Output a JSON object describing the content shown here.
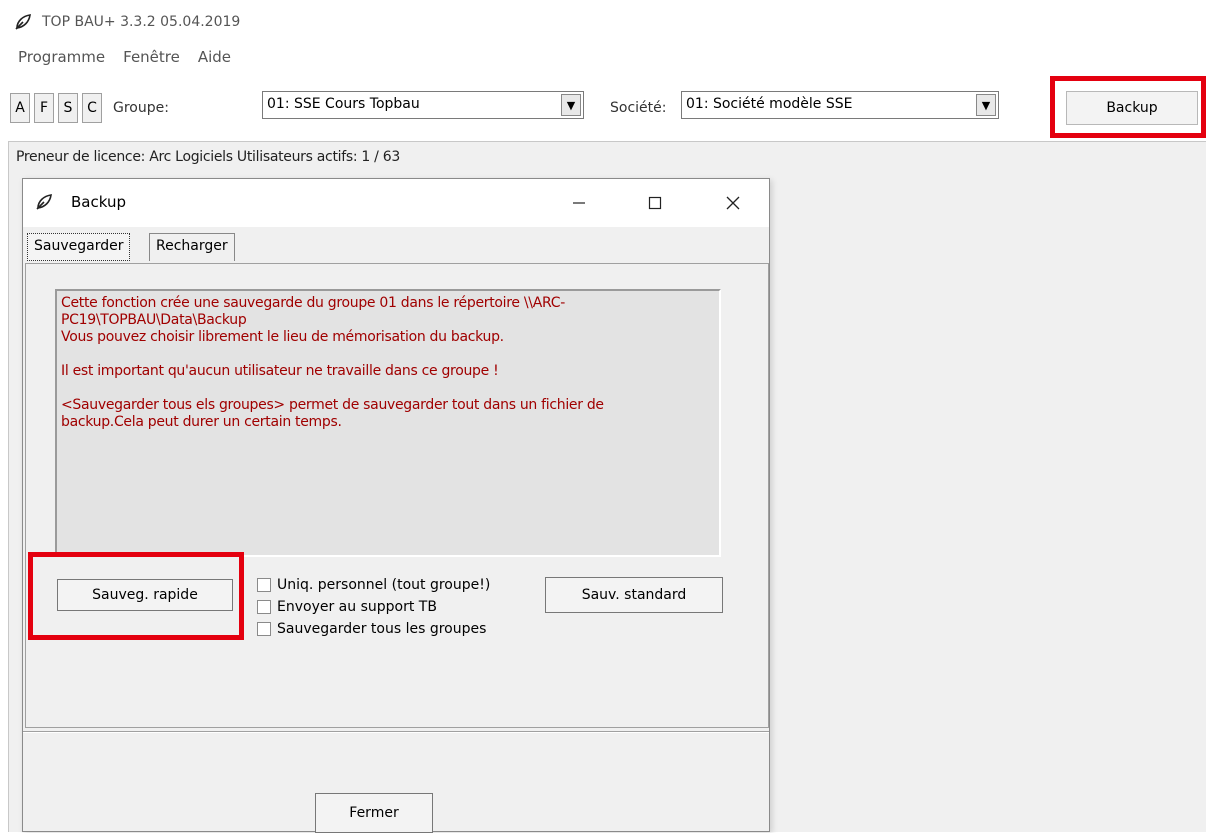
{
  "app": {
    "title": "TOP BAU+ 3.3.2  05.04.2019"
  },
  "menu": {
    "items": [
      "Programme",
      "Fenêtre",
      "Aide"
    ]
  },
  "toolbar": {
    "buttons": [
      "A",
      "F",
      "S",
      "C"
    ],
    "group_label": "Groupe:",
    "group_value": "01: SSE Cours Topbau",
    "company_label": "Société:",
    "company_value": "01: Société modèle SSE",
    "backup_label": "Backup"
  },
  "status": {
    "licence": "Preneur de licence: Arc Logiciels   Utilisateurs actifs: 1 / 63"
  },
  "dialog": {
    "title": "Backup",
    "tabs": [
      "Sauvegarder",
      "Recharger"
    ],
    "info": {
      "line1": "Cette fonction crée une sauvegarde du groupe 01 dans le répertoire \\\\ARC-\nPC19\\TOPBAU\\Data\\Backup\nVous pouvez choisir librement le lieu de mémorisation du backup.",
      "line2": "Il est important qu'aucun utilisateur ne travaille dans ce groupe !",
      "line3": "<Sauvegarder tous els groupes> permet de sauvegarder tout dans un fichier de\nbackup.Cela peut durer un certain temps."
    },
    "quick_save_label": "Sauveg. rapide",
    "standard_save_label": "Sauv. standard",
    "checkboxes": [
      "Uniq. personnel (tout groupe!)",
      "Envoyer au support TB",
      "Sauvegarder tous les groupes"
    ],
    "close_label": "Fermer"
  },
  "colors": {
    "highlight": "#e4000f",
    "info_text": "#a00000"
  }
}
